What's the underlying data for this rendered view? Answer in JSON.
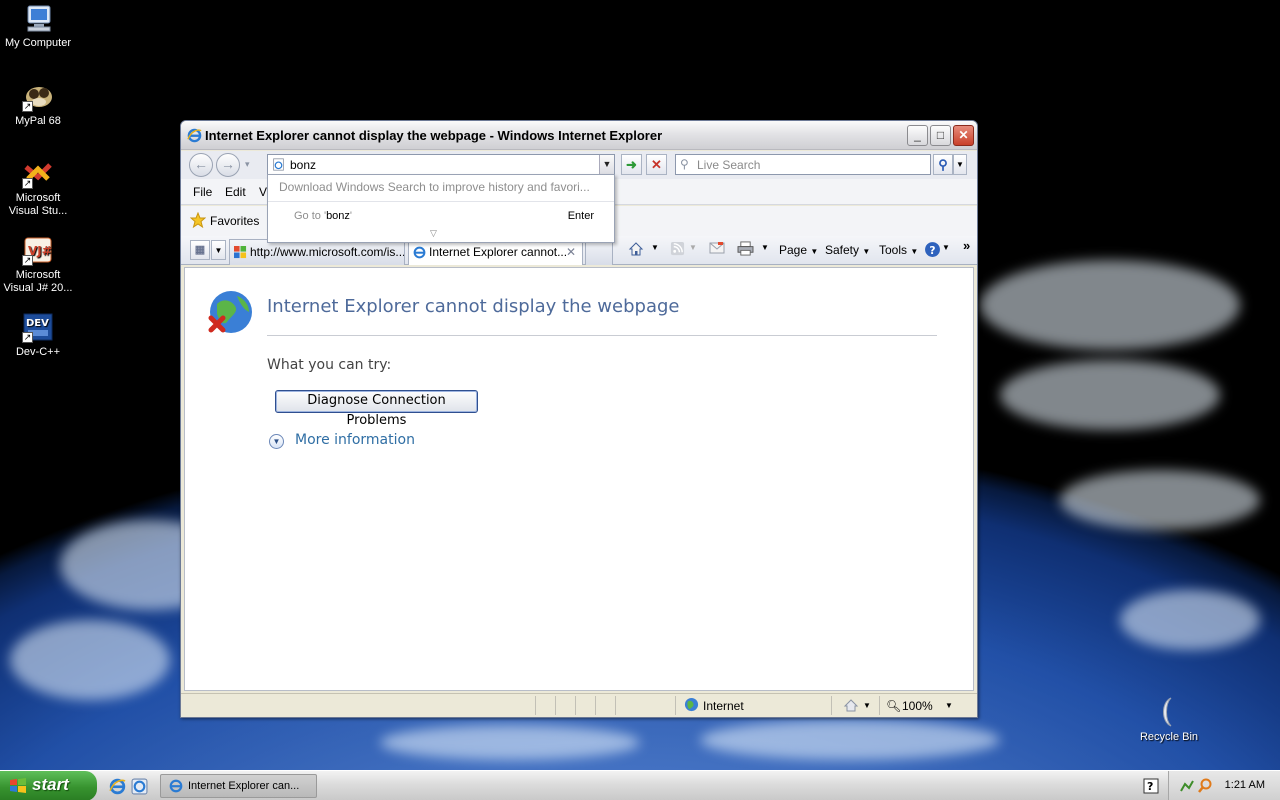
{
  "desktop": {
    "icons": [
      {
        "label": "My Computer",
        "icon": "my-computer-icon"
      },
      {
        "label": "MyPal 68",
        "icon": "mypal-icon"
      },
      {
        "label": "Microsoft Visual Stu...",
        "icon": "visual-studio-icon"
      },
      {
        "label": "Microsoft Visual J# 20...",
        "icon": "visual-jsharp-icon"
      },
      {
        "label": "Dev-C++",
        "icon": "dev-cpp-icon"
      },
      {
        "label": "Recycle Bin",
        "icon": "recycle-bin-icon"
      }
    ]
  },
  "window": {
    "title": "Internet Explorer cannot display the webpage - Windows Internet Explorer",
    "buttons": {
      "minimize": "_",
      "maximize": "□",
      "close": "✕"
    }
  },
  "navbar": {
    "address_value": "bonz",
    "search_placeholder": "Live Search"
  },
  "autocomplete": {
    "download_text": "Download Windows Search to improve history and favori...",
    "goto_prefix": "Go to '",
    "goto_term": "bonz",
    "goto_suffix": "'",
    "enter_label": "Enter"
  },
  "menubar": {
    "file": "File",
    "edit": "Edit",
    "view": "Vi"
  },
  "favorites": {
    "label": "Favorites"
  },
  "tabs": [
    {
      "label": "http://www.microsoft.com/is...",
      "active": false
    },
    {
      "label": "Internet Explorer cannot...",
      "active": true
    }
  ],
  "commandbar": {
    "page": "Page",
    "safety": "Safety",
    "tools": "Tools"
  },
  "content": {
    "error_title": "Internet Explorer cannot display the webpage",
    "try_text": "What you can try:",
    "diagnose_button": "Diagnose Connection Problems",
    "more_info": "More information"
  },
  "statusbar": {
    "zone": "Internet",
    "zoom": "100%"
  },
  "taskbar": {
    "start": "start",
    "task_ie": "Internet Explorer can...",
    "clock": "1:21 AM"
  },
  "colors": {
    "title_link_blue": "#4e6a9a",
    "more_info_blue": "#2f6ea4",
    "start_green": "#37932f"
  }
}
